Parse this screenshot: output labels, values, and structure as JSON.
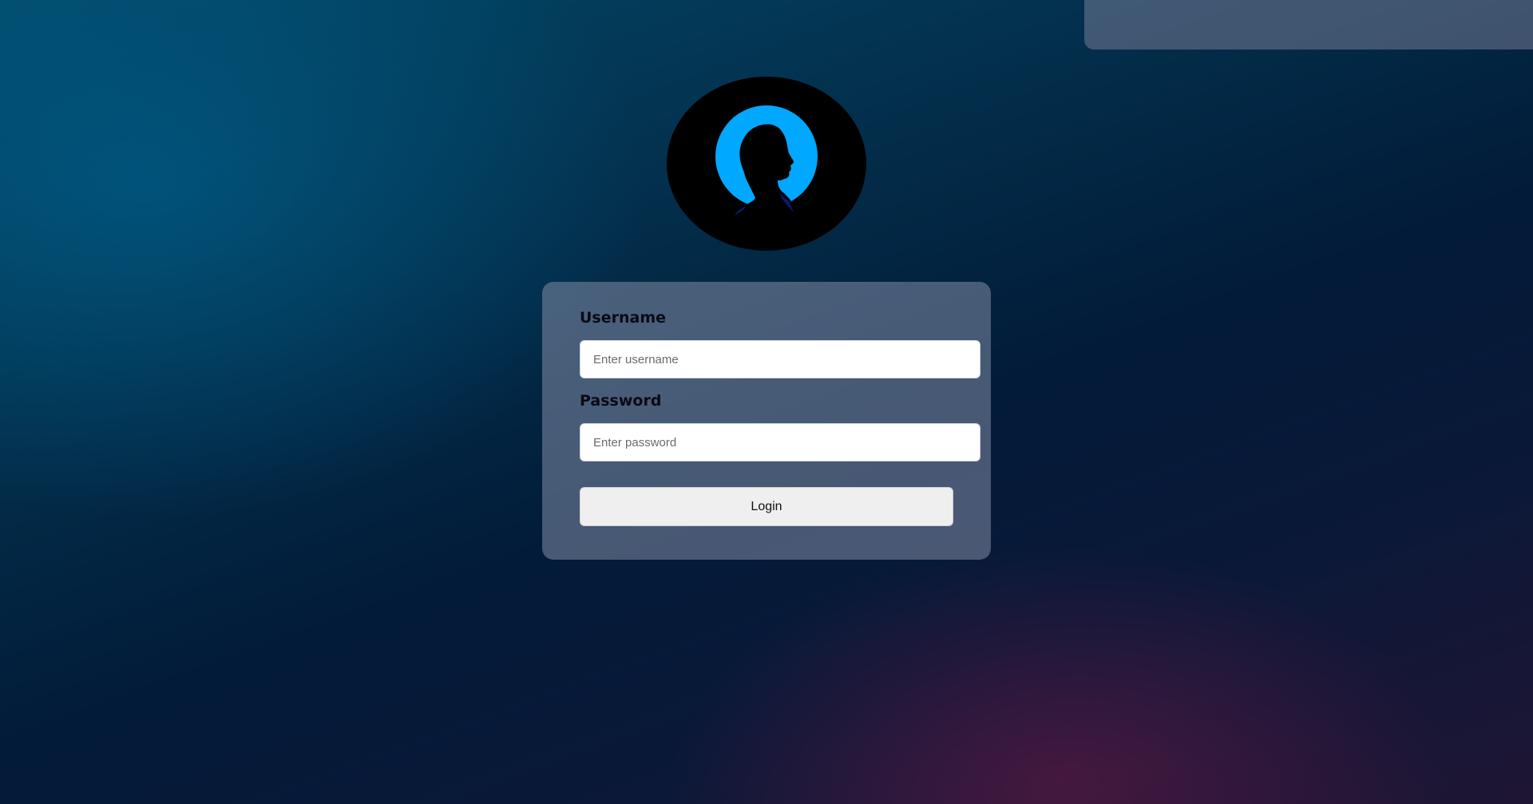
{
  "banner": {},
  "avatar": {
    "icon": "user-silhouette-icon",
    "ring_color": "#00a8ff"
  },
  "form": {
    "username": {
      "label": "Username",
      "placeholder": "Enter username",
      "value": ""
    },
    "password": {
      "label": "Password",
      "placeholder": "Enter password",
      "value": ""
    },
    "login_label": "Login"
  },
  "colors": {
    "card_background": "#828ca5",
    "button_background": "#efefef"
  }
}
